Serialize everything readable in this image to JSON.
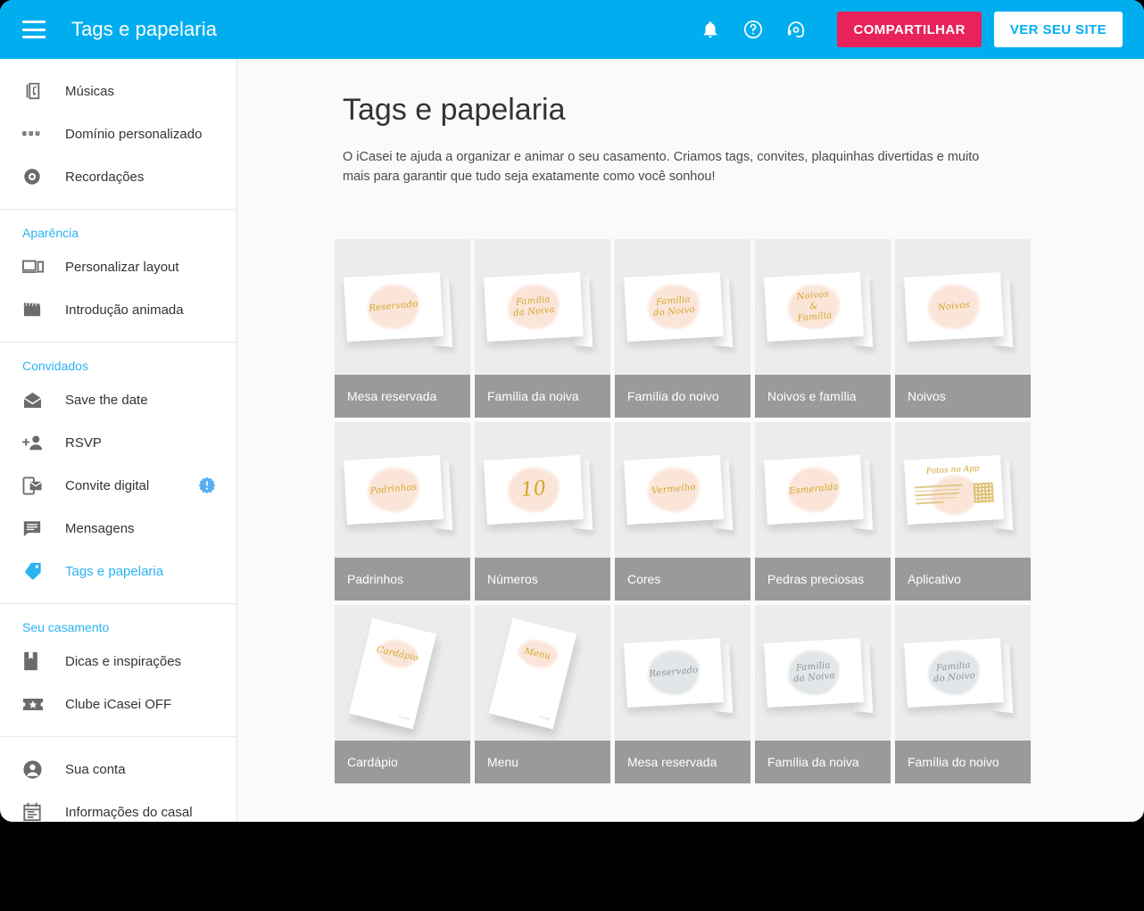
{
  "header": {
    "menu_icon": "hamburger-icon",
    "title": "Tags e papelaria",
    "icons": [
      {
        "name": "notification-bell-icon"
      },
      {
        "name": "help-circle-icon"
      },
      {
        "name": "support-headset-icon"
      }
    ],
    "share_label": "COMPARTILHAR",
    "view_site_label": "VER SEU SITE",
    "share_color": "#E8225B",
    "bar_color": "#00AEEF",
    "view_site_text_color": "#00AEEF"
  },
  "sidebar": {
    "accent_color": "#2BB3F3",
    "groups": [
      {
        "title": null,
        "items": [
          {
            "label": "Músicas",
            "icon": "music-library-icon",
            "active": false,
            "badge": false
          },
          {
            "label": "Domínio personalizado",
            "icon": "www-icon",
            "active": false,
            "badge": false
          },
          {
            "label": "Recordações",
            "icon": "disc-icon",
            "active": false,
            "badge": false
          }
        ]
      },
      {
        "title": "Aparência",
        "items": [
          {
            "label": "Personalizar layout",
            "icon": "devices-icon",
            "active": false,
            "badge": false
          },
          {
            "label": "Introdução animada",
            "icon": "clapperboard-icon",
            "active": false,
            "badge": false
          }
        ]
      },
      {
        "title": "Convidados",
        "items": [
          {
            "label": "Save the date",
            "icon": "envelope-icon",
            "active": false,
            "badge": false
          },
          {
            "label": "RSVP",
            "icon": "person-add-icon",
            "active": false,
            "badge": false
          },
          {
            "label": "Convite digital",
            "icon": "mobile-invite-icon",
            "active": false,
            "badge": true
          },
          {
            "label": "Mensagens",
            "icon": "message-icon",
            "active": false,
            "badge": false
          },
          {
            "label": "Tags e papelaria",
            "icon": "tag-icon",
            "active": true,
            "badge": false
          }
        ]
      },
      {
        "title": "Seu casamento",
        "items": [
          {
            "label": "Dicas e inspirações",
            "icon": "bookmark-icon",
            "active": false,
            "badge": false
          },
          {
            "label": "Clube iCasei OFF",
            "icon": "ticket-star-icon",
            "active": false,
            "badge": false
          }
        ]
      },
      {
        "title": null,
        "items": [
          {
            "label": "Sua conta",
            "icon": "account-circle-icon",
            "active": false,
            "badge": false
          },
          {
            "label": "Informações do casal",
            "icon": "calendar-icon",
            "active": false,
            "badge": false
          }
        ]
      }
    ]
  },
  "main": {
    "title": "Tags e papelaria",
    "description": "O iCasei te ajuda a organizar e animar o seu casamento. Criamos tags, convites, plaquinhas divertidas e muito mais para garantir que tudo seja exatamente como você sonhou!",
    "label_bar_color": "#9a9a9a",
    "thumb_bg_color": "#ececec",
    "cards": [
      {
        "label": "Mesa reservada",
        "art": "tent",
        "art_text": "Reservado",
        "art_style": "gold",
        "size": "normal"
      },
      {
        "label": "Família da noiva",
        "art": "tent",
        "art_text": "Família\nda Noiva",
        "art_style": "gold",
        "size": "normal"
      },
      {
        "label": "Família do noivo",
        "art": "tent",
        "art_text": "Família\ndo Noivo",
        "art_style": "gold",
        "size": "normal"
      },
      {
        "label": "Noivos e família",
        "art": "tent",
        "art_text": "Noivos\n&\nFamília",
        "art_style": "gold",
        "size": "normal"
      },
      {
        "label": "Noivos",
        "art": "tent",
        "art_text": "Noivos",
        "art_style": "gold",
        "size": "normal"
      },
      {
        "label": "Padrinhos",
        "art": "tent",
        "art_text": "Padrinhos",
        "art_style": "gold",
        "size": "normal"
      },
      {
        "label": "Números",
        "art": "tent",
        "art_text": "10",
        "art_style": "gold",
        "size": "big"
      },
      {
        "label": "Cores",
        "art": "tent",
        "art_text": "Vermelho",
        "art_style": "gold",
        "size": "normal"
      },
      {
        "label": "Pedras preciosas",
        "art": "tent",
        "art_text": "Esmeralda",
        "art_style": "gold",
        "size": "normal"
      },
      {
        "label": "Aplicativo",
        "art": "app",
        "art_text": "Fotos no App",
        "art_style": "gold",
        "size": "normal"
      },
      {
        "label": "Cardápio",
        "art": "flat",
        "art_text": "Cardápio",
        "art_style": "gold",
        "size": "normal"
      },
      {
        "label": "Menu",
        "art": "flat",
        "art_text": "Menu",
        "art_style": "gold",
        "size": "normal"
      },
      {
        "label": "Mesa reservada",
        "art": "tent",
        "art_text": "Reservado",
        "art_style": "gray",
        "size": "normal"
      },
      {
        "label": "Família da noiva",
        "art": "tent",
        "art_text": "Família\nda Noiva",
        "art_style": "gray",
        "size": "normal"
      },
      {
        "label": "Família do noivo",
        "art": "tent",
        "art_text": "Família\ndo Noivo",
        "art_style": "gray",
        "size": "normal"
      }
    ]
  }
}
